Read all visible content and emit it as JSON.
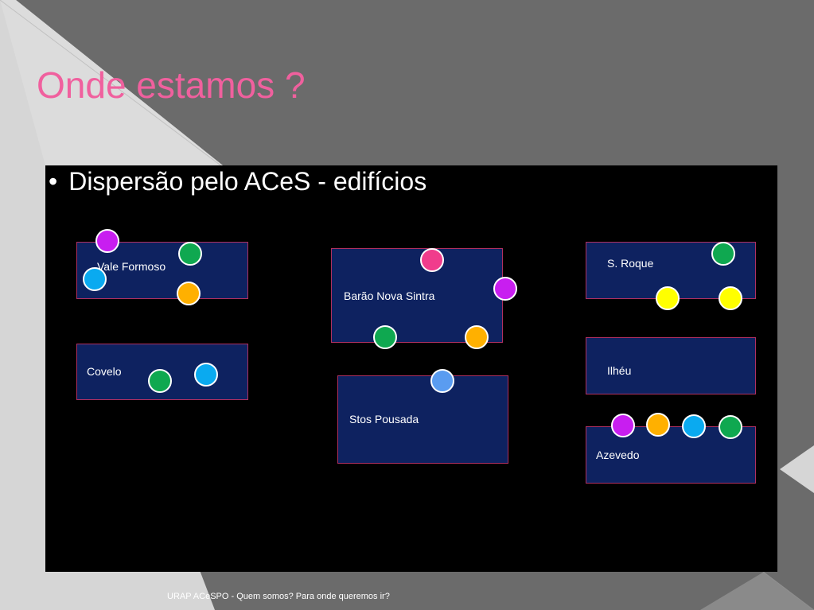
{
  "slide": {
    "title": "Onde estamos ?",
    "bullet": "Dispersão pelo ACeS - edifícios",
    "footer": "URAP ACeSPO - Quem somos? Para onde queremos ir?"
  },
  "colors": {
    "title": "#f0609e",
    "building_fill": "#0e2260",
    "building_border": "#b03060",
    "purple": "#c81ef0",
    "green": "#0fa850",
    "cyan": "#0aaaf0",
    "orange": "#ffb000",
    "pink": "#f03c8c",
    "yellow": "#ffff00",
    "blue": "#5a9cf0"
  },
  "buildings": {
    "vale_formoso": {
      "label": "Vale Formoso",
      "markers": [
        "purple",
        "green",
        "cyan",
        "orange"
      ]
    },
    "covelo": {
      "label": "Covelo",
      "markers": [
        "green",
        "cyan"
      ]
    },
    "barao_nova_sintra": {
      "label": "Barão Nova Sintra",
      "markers": [
        "pink",
        "purple",
        "green",
        "orange"
      ]
    },
    "stos_pousada": {
      "label": "Stos Pousada",
      "markers": [
        "blue"
      ]
    },
    "s_roque": {
      "label": "S. Roque",
      "markers": [
        "green",
        "yellow",
        "yellow"
      ]
    },
    "ilheu": {
      "label": "Ilhéu",
      "markers": []
    },
    "azevedo": {
      "label": "Azevedo",
      "markers": [
        "purple",
        "orange",
        "cyan",
        "green"
      ]
    }
  }
}
